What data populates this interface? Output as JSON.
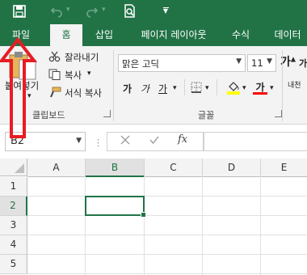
{
  "quick_access": {
    "save_icon": "save-icon",
    "undo_icon": "undo-icon",
    "redo_icon": "redo-icon",
    "print_preview_icon": "print-preview-icon",
    "customize_icon": "customize-qat-icon"
  },
  "tabs": [
    {
      "label": "파일"
    },
    {
      "label": "홈"
    },
    {
      "label": "삽입"
    },
    {
      "label": "페이지 레이아웃"
    },
    {
      "label": "수식"
    },
    {
      "label": "데이터"
    }
  ],
  "ribbon": {
    "clipboard": {
      "paste_label": "붙여넣기",
      "cut_label": "잘라내기",
      "copy_label": "복사",
      "format_painter_label": "서식 복사",
      "group_label": "클립보드"
    },
    "font": {
      "font_name": "맑은 고딕",
      "font_size": "11",
      "bold_label": "가",
      "italic_label": "가",
      "underline_label": "가",
      "font_color_label": "가",
      "group_label": "글꼴",
      "grow_label": "가",
      "shrink_label": "가"
    },
    "alignment": {
      "wrap_partial": "내천"
    }
  },
  "formula_bar": {
    "name_box": "B2",
    "fx_label": "fx",
    "cancel_icon": "cancel-icon",
    "enter_icon": "check-icon"
  },
  "sheet": {
    "columns": [
      "A",
      "B",
      "C",
      "D",
      "E"
    ],
    "rows": [
      "1",
      "2",
      "3",
      "4",
      "5"
    ],
    "selected_cell": "B2"
  },
  "annotation": {
    "arrow_color": "#e81c24"
  },
  "colors": {
    "accent": "#217346",
    "highlight_yellow": "#ffff00",
    "font_red": "#ff0000"
  }
}
